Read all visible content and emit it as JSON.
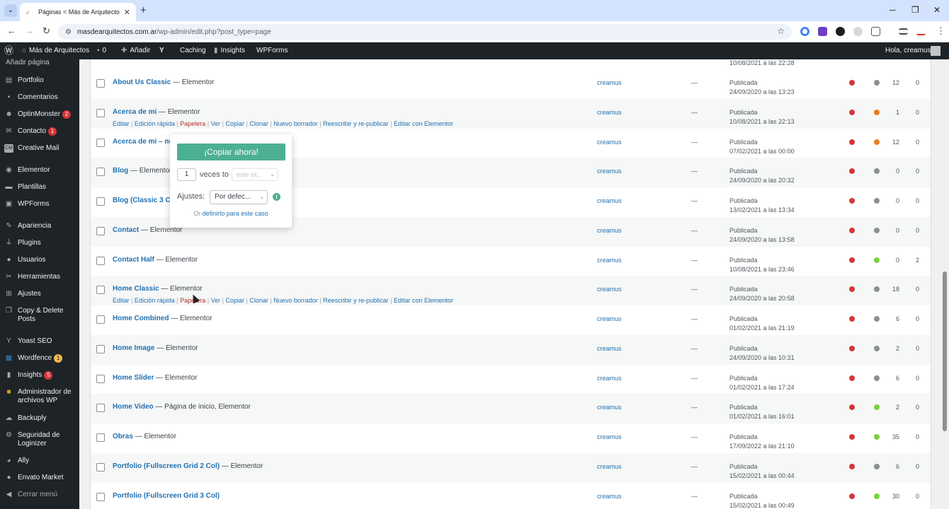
{
  "browser": {
    "tab_title": "Páginas < Más de Arquitectos",
    "url_host": "masdearquitectos.com.ar",
    "url_path": "/wp-admin/edit.php?post_type=page"
  },
  "admin_bar": {
    "site_name": "Más de Arquitectos",
    "comments_count": "0",
    "add_label": "Añadir",
    "caching_label": "Caching",
    "insights_label": "Insights",
    "wpforms_label": "WPForms",
    "greeting": "Hola, creamus"
  },
  "sidebar": {
    "submenu_add_page": "Añadir página",
    "items": [
      {
        "label": "Portfolio",
        "icon": "portfolio-icon"
      },
      {
        "label": "Comentarios",
        "icon": "comments-icon"
      },
      {
        "label": "OptinMonster",
        "icon": "optinmonster-icon",
        "badge": "2"
      },
      {
        "label": "Contacto",
        "icon": "mail-icon",
        "badge": "1"
      },
      {
        "label": "Creative Mail",
        "icon": "creative-mail-icon"
      },
      {
        "label": "Elementor",
        "icon": "elementor-icon"
      },
      {
        "label": "Plantillas",
        "icon": "templates-icon"
      },
      {
        "label": "WPForms",
        "icon": "wpforms-icon"
      },
      {
        "label": "Apariencia",
        "icon": "appearance-icon"
      },
      {
        "label": "Plugins",
        "icon": "plugins-icon"
      },
      {
        "label": "Usuarios",
        "icon": "users-icon"
      },
      {
        "label": "Herramientas",
        "icon": "tools-icon"
      },
      {
        "label": "Ajustes",
        "icon": "settings-icon"
      },
      {
        "label": "Copy & Delete Posts",
        "icon": "copy-delete-icon"
      },
      {
        "label": "Yoast SEO",
        "icon": "yoast-icon"
      },
      {
        "label": "Wordfence",
        "icon": "wordfence-icon",
        "badge": "1"
      },
      {
        "label": "Insights",
        "icon": "insights-icon",
        "badge": "5"
      },
      {
        "label": "Administrador de archivos WP",
        "icon": "file-manager-icon"
      },
      {
        "label": "Backuply",
        "icon": "backuply-icon"
      },
      {
        "label": "Seguridad de Loginizer",
        "icon": "loginizer-icon"
      },
      {
        "label": "Ally",
        "icon": "ally-icon"
      },
      {
        "label": "Envato Market",
        "icon": "envato-icon"
      },
      {
        "label": "Cerrar menú",
        "icon": "collapse-menu-icon"
      }
    ]
  },
  "row_actions": {
    "edit": "Editar",
    "quick_edit": "Edición rápida",
    "trash": "Papelera",
    "view": "Ver",
    "copy": "Copiar",
    "clone": "Clonar",
    "new_draft": "Nuevo borrador",
    "rewrite": "Reescribir y re-publicar",
    "elementor": "Editar con Elementor"
  },
  "top_date": "10/08/2021 a las 22:28",
  "rows": [
    {
      "title": "About Us Classic",
      "suffix": " — Elementor",
      "author": "creamus",
      "dash": "—",
      "status": "Publicada",
      "date": "24/09/2020 a las 13:23",
      "seo": "#d63638",
      "read": "#8c8f94",
      "n1": "12",
      "n2": "0"
    },
    {
      "title": "Acerca de mi",
      "suffix": " — Elementor",
      "author": "creamus",
      "dash": "—",
      "status": "Publicada",
      "date": "10/08/2021 a las 22:13",
      "seo": "#d63638",
      "read": "#e67e22",
      "n1": "1",
      "n2": "0"
    },
    {
      "title": "Acerca de mi – no –",
      "suffix": "",
      "author": "creamus",
      "dash": "—",
      "status": "Publicada",
      "date": "07/02/2021 a las 00:00",
      "seo": "#d63638",
      "read": "#e67e22",
      "n1": "12",
      "n2": "0"
    },
    {
      "title": "Blog",
      "suffix": " — Elementor",
      "author": "creamus",
      "dash": "—",
      "status": "Publicada",
      "date": "24/09/2020 a las 20:32",
      "seo": "#d63638",
      "read": "#8c8f94",
      "n1": "0",
      "n2": "0"
    },
    {
      "title": "Blog (Classic 3 Colu",
      "suffix": "",
      "author": "creamus",
      "dash": "—",
      "status": "Publicada",
      "date": "13/02/2021 a las 13:34",
      "seo": "#d63638",
      "read": "#8c8f94",
      "n1": "0",
      "n2": "0"
    },
    {
      "title": "Contact",
      "suffix": " — Elementor",
      "author": "creamus",
      "dash": "—",
      "status": "Publicada",
      "date": "24/09/2020 a las 13:58",
      "seo": "#d63638",
      "read": "#8c8f94",
      "n1": "0",
      "n2": "0"
    },
    {
      "title": "Contact Half",
      "suffix": " — Elementor",
      "author": "creamus",
      "dash": "—",
      "status": "Publicada",
      "date": "10/08/2021 a las 23:46",
      "seo": "#d63638",
      "read": "#7ad03a",
      "n1": "0",
      "n2": "2"
    },
    {
      "title": "Home Classic",
      "suffix": " — Elementor",
      "author": "creamus",
      "dash": "—",
      "status": "Publicada",
      "date": "24/09/2020 a las 20:58",
      "seo": "#d63638",
      "read": "#8c8f94",
      "n1": "18",
      "n2": "0"
    },
    {
      "title": "Home Combined",
      "suffix": " — Elementor",
      "author": "creamus",
      "dash": "—",
      "status": "Publicada",
      "date": "01/02/2021 a las 21:19",
      "seo": "#d63638",
      "read": "#8c8f94",
      "n1": "6",
      "n2": "0"
    },
    {
      "title": "Home Image",
      "suffix": " — Elementor",
      "author": "creamus",
      "dash": "—",
      "status": "Publicada",
      "date": "24/09/2020 a las 10:31",
      "seo": "#d63638",
      "read": "#8c8f94",
      "n1": "2",
      "n2": "0"
    },
    {
      "title": "Home Slider",
      "suffix": " — Elementor",
      "author": "creamus",
      "dash": "—",
      "status": "Publicada",
      "date": "01/02/2021 a las 17:24",
      "seo": "#d63638",
      "read": "#8c8f94",
      "n1": "6",
      "n2": "0"
    },
    {
      "title": "Home Video",
      "suffix": " — Página de inicio, Elementor",
      "author": "creamus",
      "dash": "—",
      "status": "Publicada",
      "date": "01/02/2021 a las 16:01",
      "seo": "#d63638",
      "read": "#7ad03a",
      "n1": "2",
      "n2": "0"
    },
    {
      "title": "Obras",
      "suffix": " — Elementor",
      "author": "creamus",
      "dash": "—",
      "status": "Publicada",
      "date": "17/09/2022 a las 21:10",
      "seo": "#d63638",
      "read": "#7ad03a",
      "n1": "35",
      "n2": "0"
    },
    {
      "title": "Portfolio (Fullscreen Grid 2 Col)",
      "suffix": " — Elementor",
      "author": "creamus",
      "dash": "—",
      "status": "Publicada",
      "date": "15/02/2021 a las 00:44",
      "seo": "#d63638",
      "read": "#8c8f94",
      "n1": "6",
      "n2": "0"
    },
    {
      "title": "Portfolio (Fullscreen Grid 3 Col)",
      "suffix": "",
      "author": "creamus",
      "dash": "—",
      "status": "Publicada",
      "date": "15/02/2021 a las 00:49",
      "seo": "#d63638",
      "read": "#7ad03a",
      "n1": "30",
      "n2": "0"
    }
  ],
  "copy_popup": {
    "button_label": "¡Copiar ahora!",
    "times_value": "1",
    "times_label": "veces to",
    "destination_placeholder": "este sit...",
    "settings_label": "Ajustes:",
    "settings_value": "Por defec...",
    "or_label": "Or",
    "define_link": "definirlo para este caso"
  }
}
